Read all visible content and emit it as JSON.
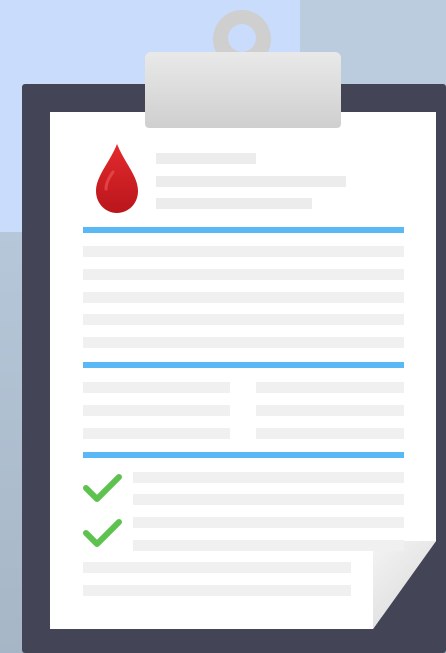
{
  "icons": {
    "clipboard": "clipboard-icon",
    "blood_drop": "blood-drop-icon",
    "check": "check-icon"
  },
  "colors": {
    "background_light": "#c9dcfb",
    "board": "#434556",
    "paper": "#ffffff",
    "divider_blue": "#5ab8f5",
    "blood_red": "#d41f24",
    "check_green": "#5ec24f",
    "text_placeholder": "#ececec"
  },
  "checklist": {
    "checked_items": 2
  }
}
